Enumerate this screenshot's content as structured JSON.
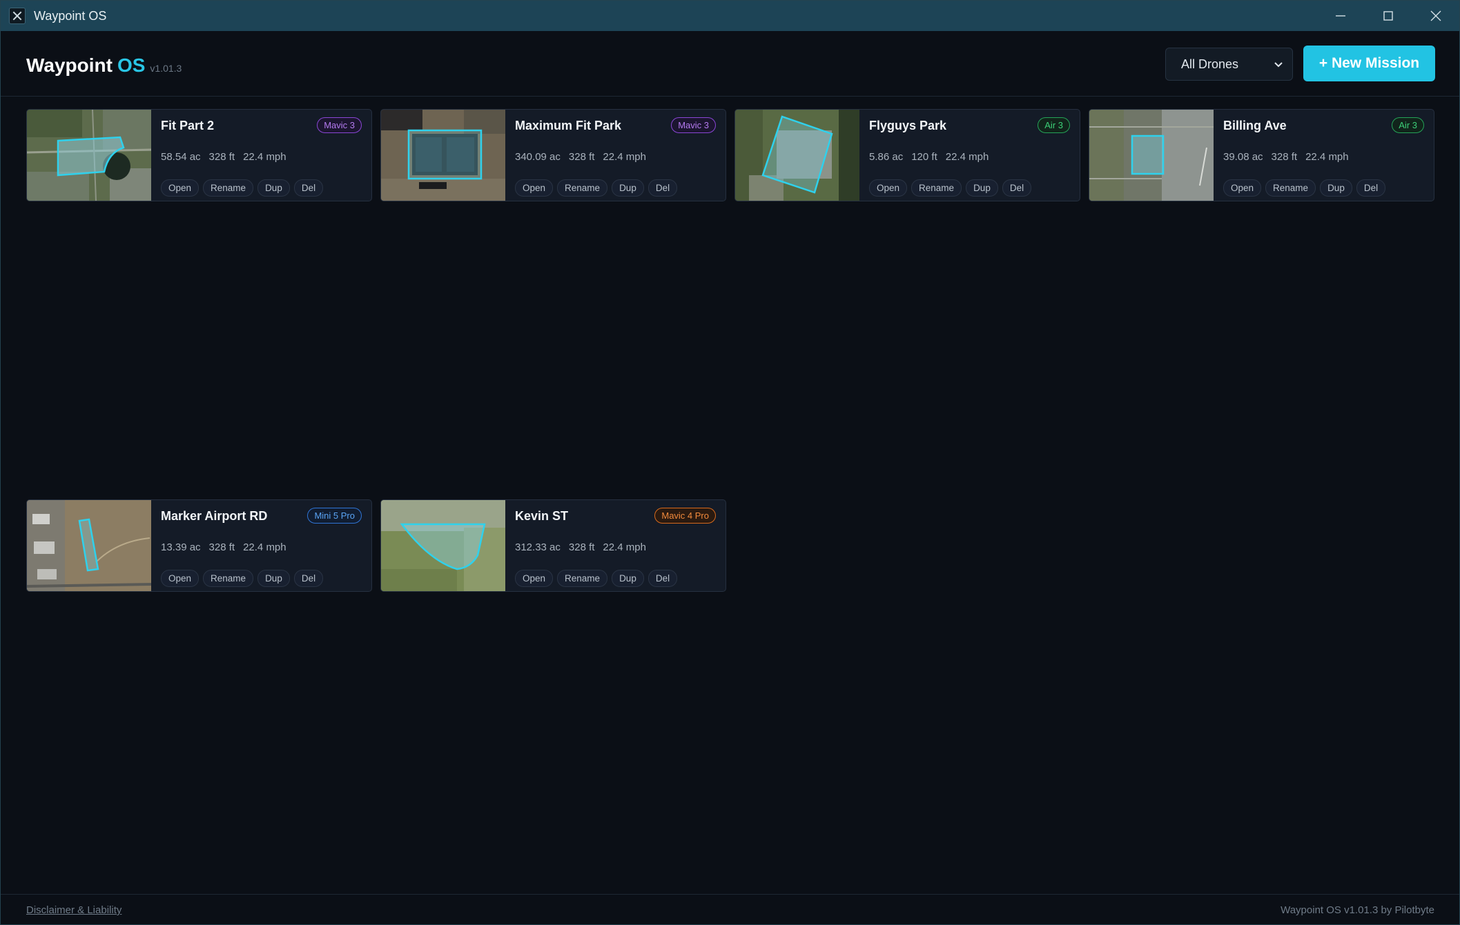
{
  "window": {
    "title": "Waypoint OS"
  },
  "header": {
    "brand_name": "Waypoint",
    "brand_os": "OS",
    "version": "v1.01.3",
    "drone_filter": "All Drones",
    "new_mission_label": "+ New Mission"
  },
  "missions": [
    {
      "name": "Fit Part 2",
      "drone": "Mavic 3",
      "badge_color": "#a35be8",
      "area": "58.54 ac",
      "altitude": "328 ft",
      "speed": "22.4 mph",
      "actions": [
        "Open",
        "Rename",
        "Dup",
        "Del"
      ]
    },
    {
      "name": "Maximum Fit Park",
      "drone": "Mavic 3",
      "badge_color": "#a35be8",
      "area": "340.09 ac",
      "altitude": "328 ft",
      "speed": "22.4 mph",
      "actions": [
        "Open",
        "Rename",
        "Dup",
        "Del"
      ]
    },
    {
      "name": "Flyguys Park",
      "drone": "Air 3",
      "badge_color": "#2fbf6a",
      "area": "5.86 ac",
      "altitude": "120 ft",
      "speed": "22.4 mph",
      "actions": [
        "Open",
        "Rename",
        "Dup",
        "Del"
      ]
    },
    {
      "name": "Billing Ave",
      "drone": "Air 3",
      "badge_color": "#2fbf6a",
      "area": "39.08 ac",
      "altitude": "328 ft",
      "speed": "22.4 mph",
      "actions": [
        "Open",
        "Rename",
        "Dup",
        "Del"
      ]
    },
    {
      "name": "Marker Airport RD",
      "drone": "Mini 5 Pro",
      "badge_color": "#3f8ef0",
      "area": "13.39 ac",
      "altitude": "328 ft",
      "speed": "22.4 mph",
      "actions": [
        "Open",
        "Rename",
        "Dup",
        "Del"
      ]
    },
    {
      "name": "Kevin ST",
      "drone": "Mavic 4 Pro",
      "badge_color": "#ef7d2c",
      "area": "312.33 ac",
      "altitude": "328 ft",
      "speed": "22.4 mph",
      "actions": [
        "Open",
        "Rename",
        "Dup",
        "Del"
      ]
    }
  ],
  "footer": {
    "disclaimer": "Disclaimer & Liability",
    "credit": "Waypoint OS v1.01.3 by Pilotbyte"
  },
  "colors": {
    "accent": "#22c3e3",
    "background": "#0b0f16",
    "card": "#141b27",
    "titlebar": "#1d4456"
  }
}
